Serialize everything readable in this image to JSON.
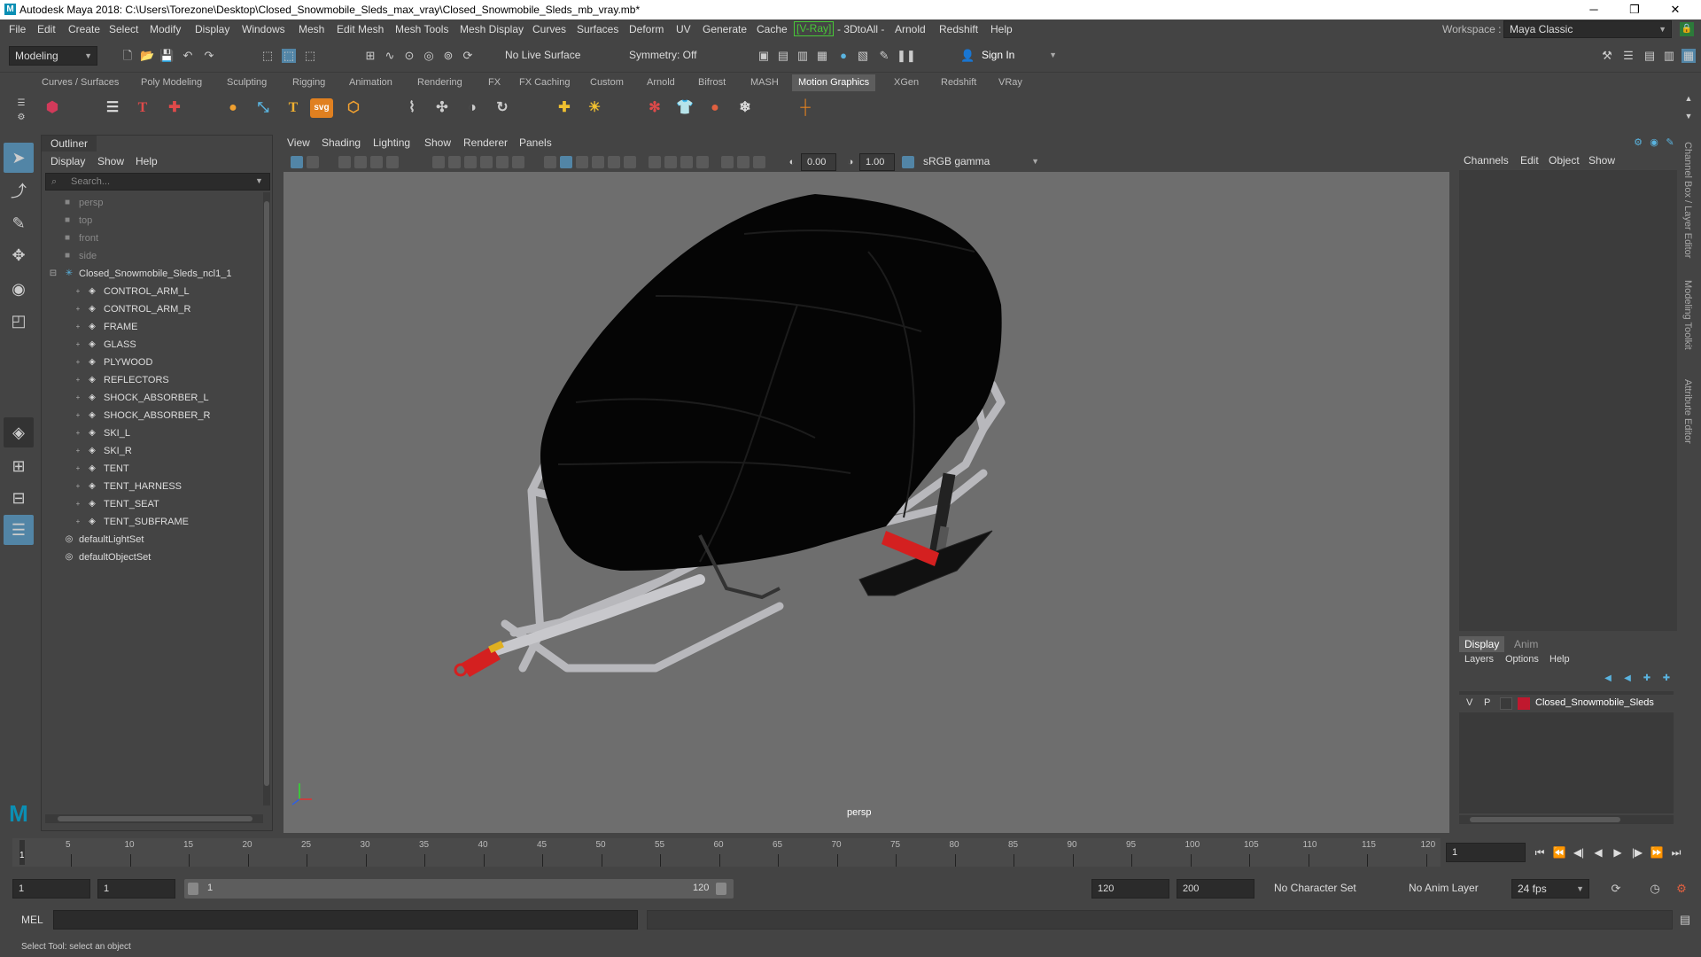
{
  "window": {
    "title": "Autodesk Maya 2018: C:\\Users\\Torezone\\Desktop\\Closed_Snowmobile_Sleds_max_vray\\Closed_Snowmobile_Sleds_mb_vray.mb*",
    "minimize": "─",
    "restore": "❐",
    "close": "✕"
  },
  "menubar": [
    "File",
    "Edit",
    "Create",
    "Select",
    "Modify",
    "Display",
    "Windows",
    "Mesh",
    "Edit Mesh",
    "Mesh Tools",
    "Mesh Display",
    "Curves",
    "Surfaces",
    "Deform",
    "UV",
    "Generate",
    "Cache",
    "V-Ray",
    "3DtoAll",
    "Arnold",
    "Redshift",
    "Help"
  ],
  "workspace": {
    "label": "Workspace :",
    "value": "Maya Classic"
  },
  "statusline": {
    "mode": "Modeling",
    "live_surface": "No Live Surface",
    "symmetry": "Symmetry: Off",
    "sign_in": "Sign In"
  },
  "shelf_tabs": [
    "Curves / Surfaces",
    "Poly Modeling",
    "Sculpting",
    "Rigging",
    "Animation",
    "Rendering",
    "FX",
    "FX Caching",
    "Custom",
    "Arnold",
    "Bifrost",
    "MASH",
    "Motion Graphics",
    "XGen",
    "Redshift",
    "VRay"
  ],
  "active_shelf_tab": "Motion Graphics",
  "shelf_icons": {
    "text_tool": "T",
    "type_tool": "T",
    "svg_tool": "svg"
  },
  "outliner": {
    "title": "Outliner",
    "menu": [
      "Display",
      "Show",
      "Help"
    ],
    "search_placeholder": "Search...",
    "cameras": [
      "persp",
      "top",
      "front",
      "side"
    ],
    "root_group": "Closed_Snowmobile_Sleds_ncl1_1",
    "children": [
      "CONTROL_ARM_L",
      "CONTROL_ARM_R",
      "FRAME",
      "GLASS",
      "PLYWOOD",
      "REFLECTORS",
      "SHOCK_ABSORBER_L",
      "SHOCK_ABSORBER_R",
      "SKI_L",
      "SKI_R",
      "TENT",
      "TENT_HARNESS",
      "TENT_SEAT",
      "TENT_SUBFRAME"
    ],
    "sets": [
      "defaultLightSet",
      "defaultObjectSet"
    ]
  },
  "viewport": {
    "menu": [
      "View",
      "Shading",
      "Lighting",
      "Show",
      "Renderer",
      "Panels"
    ],
    "exposure": "0.00",
    "gamma": "1.00",
    "color_space": "sRGB gamma",
    "camera_label": "persp"
  },
  "channel_box": {
    "menu": [
      "Channels",
      "Edit",
      "Object",
      "Show"
    ]
  },
  "layer_editor": {
    "tabs": [
      "Display",
      "Anim"
    ],
    "menu": [
      "Layers",
      "Options",
      "Help"
    ],
    "layer": {
      "v": "V",
      "p": "P",
      "name": "Closed_Snowmobile_Sleds",
      "color": "#c0182e"
    }
  },
  "side_tabs": [
    "Channel Box / Layer Editor",
    "Modeling Toolkit",
    "Attribute Editor"
  ],
  "timeline": {
    "ticks": [
      "5",
      "10",
      "15",
      "20",
      "25",
      "30",
      "35",
      "40",
      "45",
      "50",
      "55",
      "60",
      "65",
      "70",
      "75",
      "80",
      "85",
      "90",
      "95",
      "100",
      "105",
      "110",
      "115",
      "120"
    ],
    "start_label": "1",
    "current_frame": "1"
  },
  "range": {
    "start": "1",
    "anim_start": "1",
    "slider_start": "1",
    "slider_end": "120",
    "end": "120",
    "anim_end": "200",
    "character_set": "No Character Set",
    "anim_layer": "No Anim Layer",
    "fps": "24 fps"
  },
  "command_line": {
    "label": "MEL"
  },
  "help_line": "Select Tool: select an object",
  "colors": {
    "accent": "#5285a6",
    "viewport_bg": "#6e6e6e",
    "vray_green": "#48c838"
  }
}
